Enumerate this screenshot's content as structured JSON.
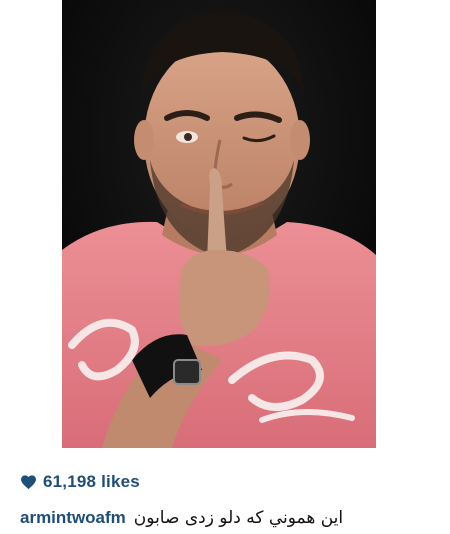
{
  "post": {
    "likes_icon": "heart-icon",
    "likes_label": "61,198 likes",
    "username": "armintwoafm",
    "caption": "این هموني كه دلو زدی صابون"
  },
  "colors": {
    "accent": "#1f4e79",
    "caption_text": "#111111",
    "background": "#ffffff",
    "shirt": "#e8868c"
  }
}
